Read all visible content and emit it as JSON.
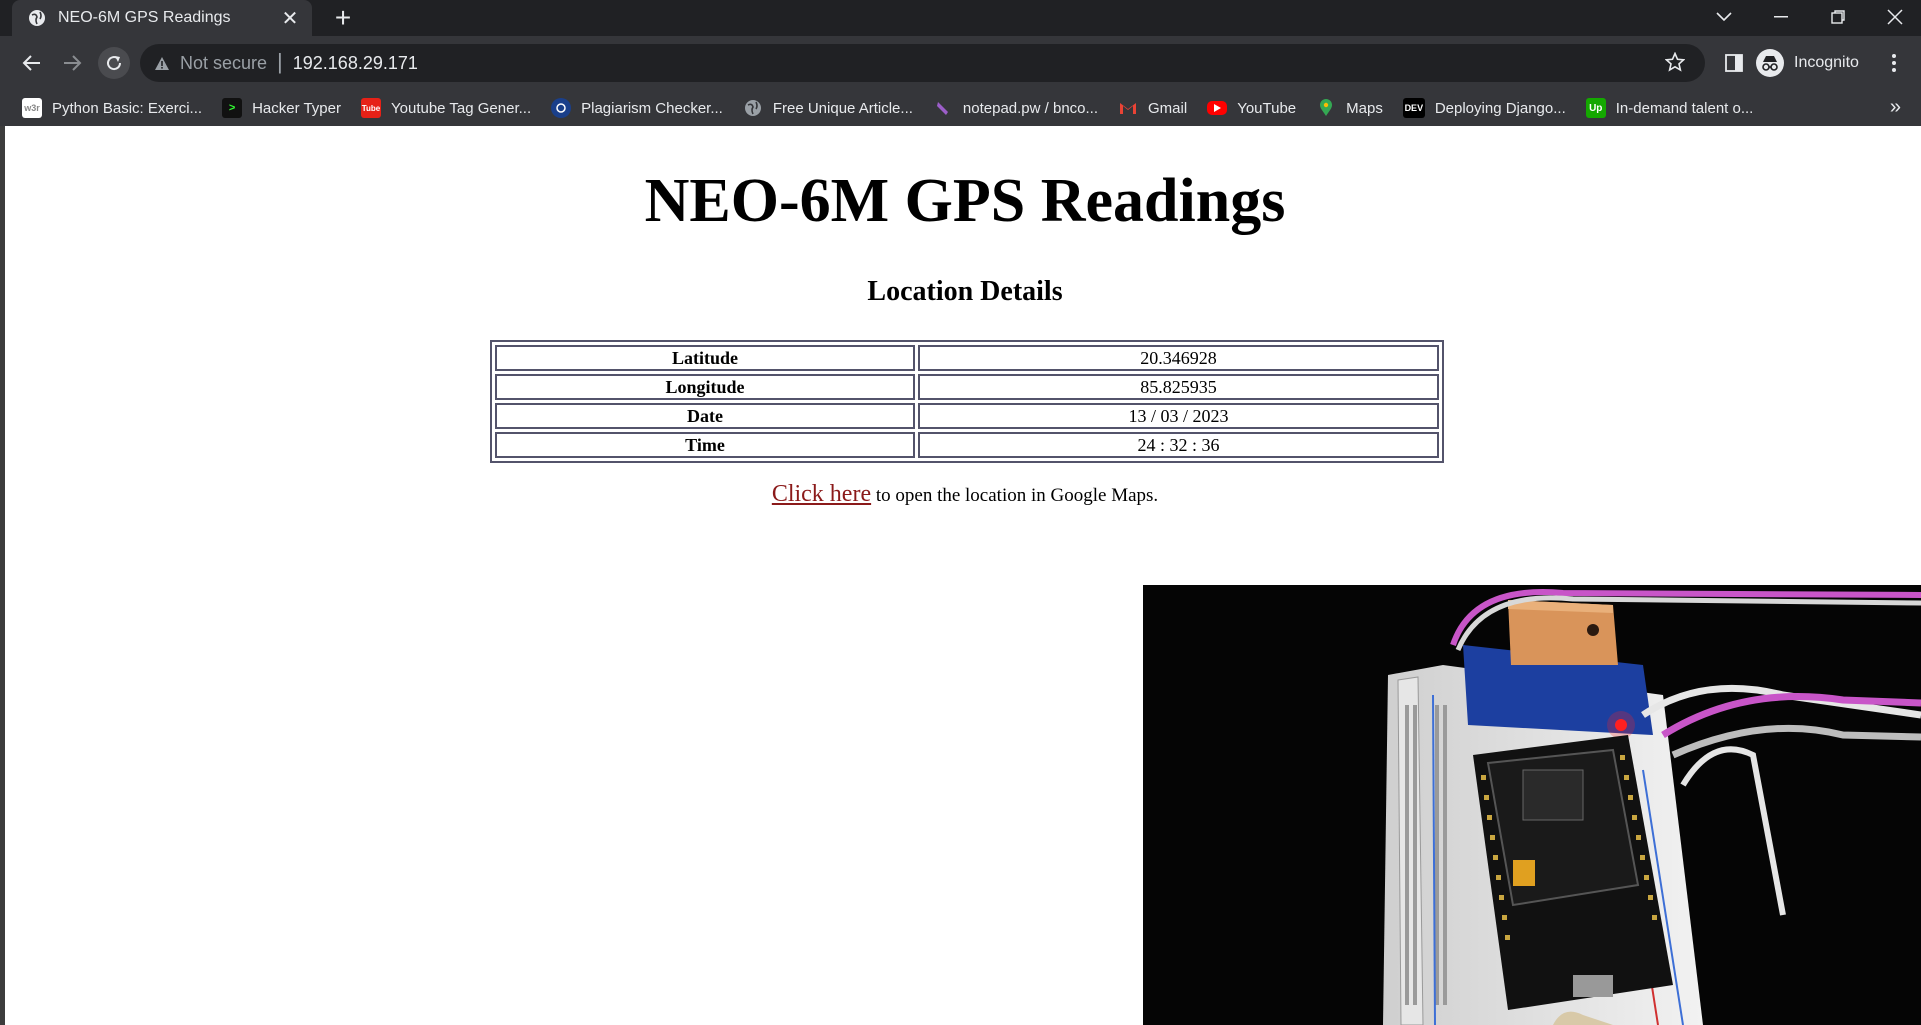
{
  "browser": {
    "tab_title": "NEO-6M GPS Readings",
    "security_label": "Not secure",
    "url": "192.168.29.171",
    "profile_label": "Incognito",
    "bookmarks": [
      {
        "label": "Python Basic: Exerci...",
        "icon": "w3resource-icon",
        "color": "#ffffff"
      },
      {
        "label": "Hacker Typer",
        "icon": "terminal-icon",
        "color": "#111111"
      },
      {
        "label": "Youtube Tag Gener...",
        "icon": "tube-icon",
        "color": "#e62117"
      },
      {
        "label": "Plagiarism Checker...",
        "icon": "checker-icon",
        "color": "#1a73e8"
      },
      {
        "label": "Free Unique Article...",
        "icon": "globe-icon",
        "color": "#9aa0a6"
      },
      {
        "label": "notepad.pw / bnco...",
        "icon": "pen-icon",
        "color": "#9c5ec9"
      },
      {
        "label": "Gmail",
        "icon": "gmail-icon",
        "color": "#ea4335"
      },
      {
        "label": "YouTube",
        "icon": "youtube-icon",
        "color": "#ff0000"
      },
      {
        "label": "Maps",
        "icon": "maps-icon",
        "color": "#34a853"
      },
      {
        "label": "Deploying Django...",
        "icon": "dev-icon",
        "color": "#000000"
      },
      {
        "label": "In-demand talent o...",
        "icon": "upwork-icon",
        "color": "#14a800"
      }
    ]
  },
  "page": {
    "heading": "NEO-6M GPS Readings",
    "subheading": "Location Details",
    "rows": [
      {
        "label": "Latitude",
        "value": "20.346928"
      },
      {
        "label": "Longitude",
        "value": "85.825935"
      },
      {
        "label": "Date",
        "value": "13 / 03 / 2023"
      },
      {
        "label": "Time",
        "value": "24 : 32 : 36"
      }
    ],
    "link_text": "Click here",
    "link_suffix": " to open the location in Google Maps."
  }
}
